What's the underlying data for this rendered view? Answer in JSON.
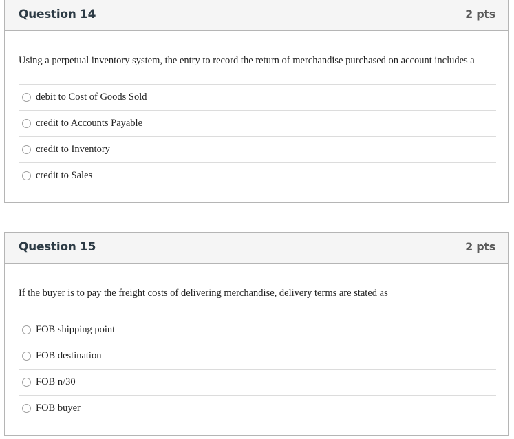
{
  "questions": [
    {
      "title": "Question 14",
      "points": "2 pts",
      "text": "Using a perpetual inventory system, the entry to record the return of merchandise purchased on account includes a",
      "answers": [
        {
          "label": "debit to Cost of Goods Sold",
          "selected": false
        },
        {
          "label": "credit to Accounts Payable",
          "selected": false
        },
        {
          "label": "credit to Inventory",
          "selected": false
        },
        {
          "label": "credit to Sales",
          "selected": false
        }
      ]
    },
    {
      "title": "Question 15",
      "points": "2 pts",
      "text": "If the buyer is to pay the freight costs of delivering merchandise, delivery terms are stated as",
      "answers": [
        {
          "label": "FOB shipping point",
          "selected": false
        },
        {
          "label": "FOB destination",
          "selected": false
        },
        {
          "label": "FOB n/30",
          "selected": false
        },
        {
          "label": "FOB buyer",
          "selected": false
        }
      ]
    }
  ]
}
